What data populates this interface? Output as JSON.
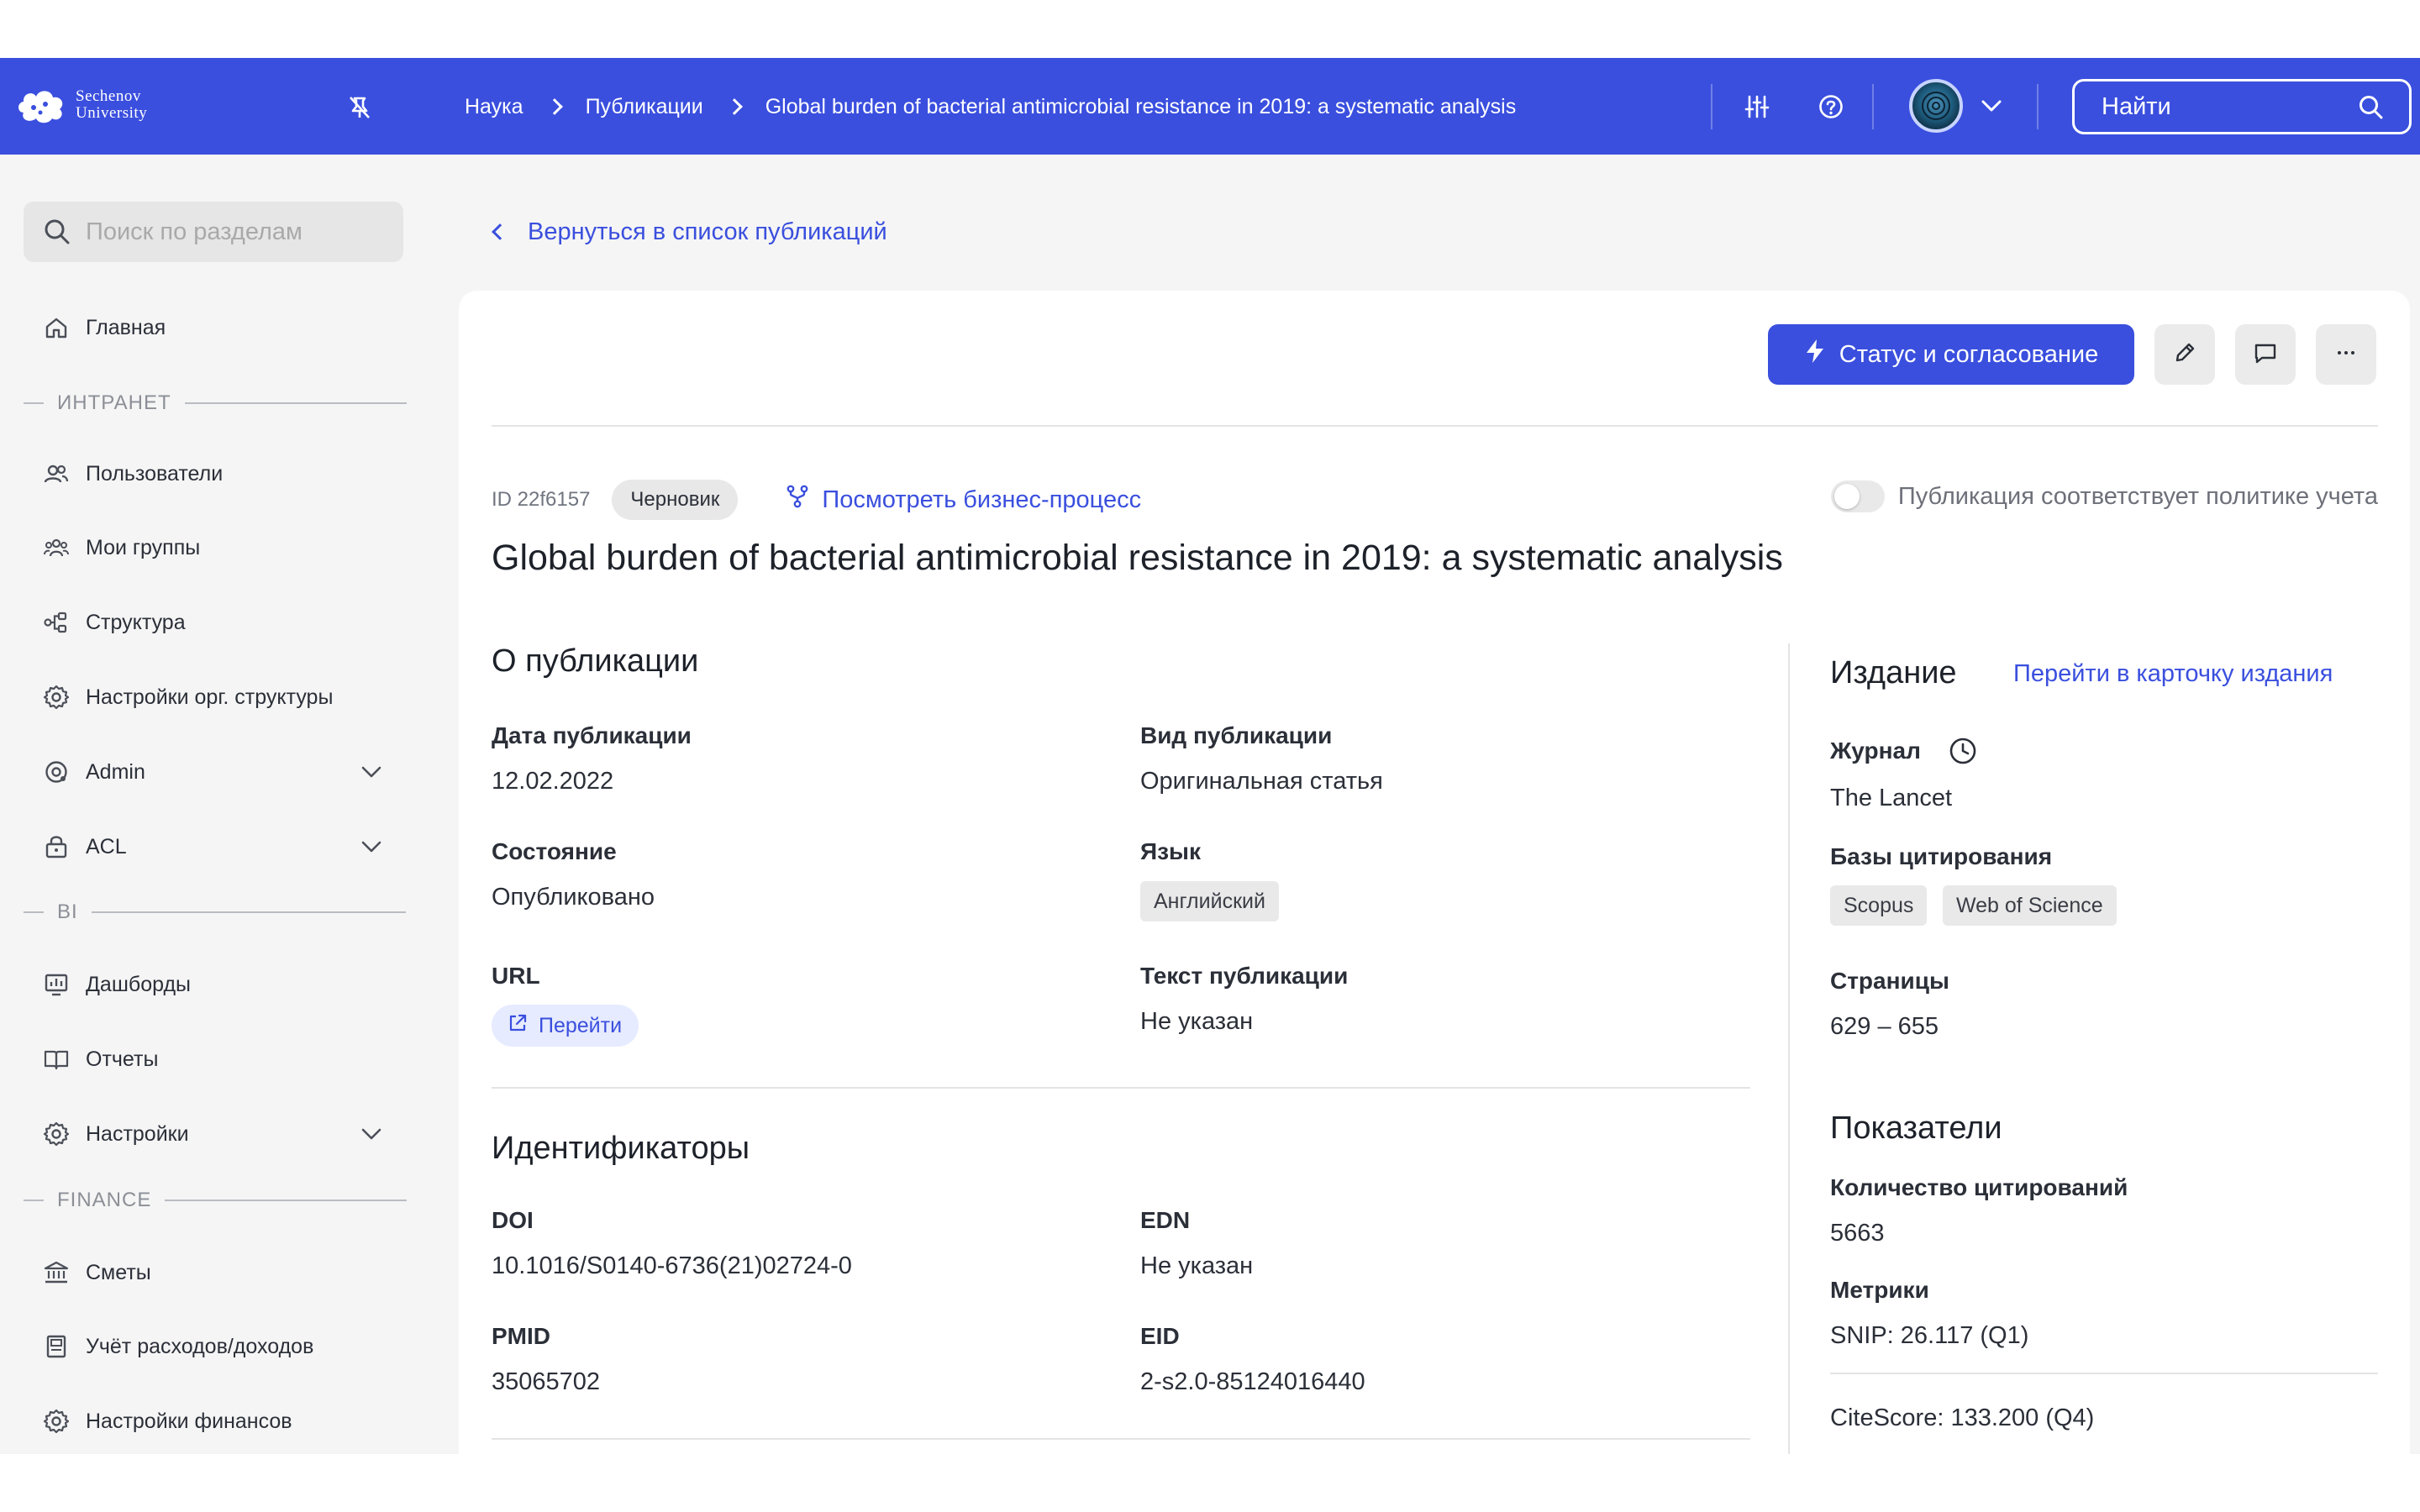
{
  "app": {
    "logo_line1": "Sechenov",
    "logo_line2": "University"
  },
  "header": {
    "breadcrumb": [
      "Наука",
      "Публикации",
      "Global burden of bacterial antimicrobial resistance in 2019: a systematic analysis"
    ],
    "search_label": "Найти",
    "accent": "#3a4fde"
  },
  "sidebar": {
    "search_placeholder": "Поиск по разделам",
    "home": "Главная",
    "sections": {
      "intranet": "ИНТРАНЕТ",
      "bi": "BI",
      "finance": "FINANCE"
    },
    "items": {
      "users": "Пользователи",
      "groups": "Мои группы",
      "structure": "Структура",
      "org_settings": "Настройки орг. структуры",
      "admin": "Admin",
      "acl": "ACL",
      "dashboards": "Дашборды",
      "reports": "Отчеты",
      "bi_settings": "Настройки",
      "estimates": "Сметы",
      "accounting": "Учёт расходов/доходов",
      "finance_settings": "Настройки финансов"
    }
  },
  "page": {
    "back_link": "Вернуться в список публикаций",
    "status_button": "Статус и согласование",
    "id_label": "ID 22f6157",
    "status_badge": "Черновик",
    "business_process_link": "Посмотреть бизнес-процесс",
    "policy_toggle_label": "Публикация соответствует политике учета",
    "policy_toggle_on": false,
    "title": "Global burden of bacterial antimicrobial resistance in 2019: a systematic analysis"
  },
  "about": {
    "section_title": "О публикации",
    "pub_date_label": "Дата публикации",
    "pub_date": "12.02.2022",
    "pub_type_label": "Вид публикации",
    "pub_type": "Оригинальная статья",
    "state_label": "Состояние",
    "state": "Опубликовано",
    "language_label": "Язык",
    "language": "Английский",
    "url_label": "URL",
    "url_link": "Перейти",
    "text_label": "Текст публикации",
    "text_value": "Не указан"
  },
  "identifiers": {
    "section_title": "Идентификаторы",
    "doi_label": "DOI",
    "doi": "10.1016/S0140-6736(21)02724-0",
    "edn_label": "EDN",
    "edn": "Не указан",
    "pmid_label": "PMID",
    "pmid": "35065702",
    "eid_label": "EID",
    "eid": "2-s2.0-85124016440"
  },
  "edition": {
    "section_title": "Издание",
    "card_link": "Перейти в карточку издания",
    "journal_label": "Журнал",
    "journal": "The Lancet",
    "citation_db_label": "Базы цитирования",
    "citation_dbs": [
      "Scopus",
      "Web of Science"
    ],
    "pages_label": "Страницы",
    "pages": "629 – 655"
  },
  "indicators": {
    "section_title": "Показатели",
    "citations_label": "Количество цитирований",
    "citations": "5663",
    "metrics_label": "Метрики",
    "snip": "SNIP: 26.117 (Q1)",
    "citescore": "CiteScore: 133.200 (Q4)"
  }
}
